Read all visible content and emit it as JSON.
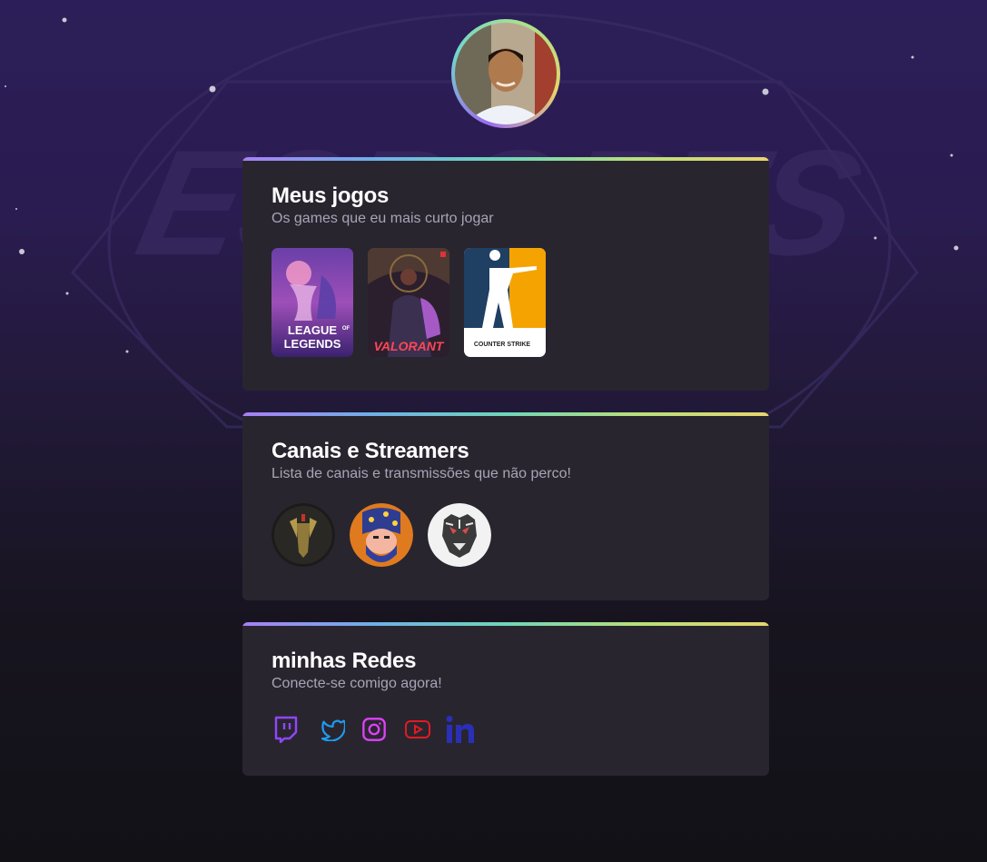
{
  "profile": {
    "avatar_alt": "Foto de perfil"
  },
  "sections": {
    "games": {
      "title": "Meus jogos",
      "subtitle": "Os games que eu mais curto jogar",
      "items": [
        {
          "name": "League of Legends",
          "line1": "LEAGUE",
          "line2": "LEGENDS",
          "small": "OF"
        },
        {
          "name": "Valorant",
          "label": "VALORANT"
        },
        {
          "name": "Counter-Strike",
          "label": "COUNTER STRIKE"
        }
      ]
    },
    "channels": {
      "title": "Canais e Streamers",
      "subtitle": "Lista de canais e transmissões que não perco!",
      "items": [
        "channel-1",
        "channel-2",
        "channel-3"
      ]
    },
    "social": {
      "title": "minhas Redes",
      "subtitle": "Conecte-se comigo agora!",
      "items": [
        {
          "icon": "twitch-icon",
          "color": "#9146ff"
        },
        {
          "icon": "twitter-icon",
          "color": "#1d9bf0"
        },
        {
          "icon": "instagram-icon",
          "color": "#e040fb"
        },
        {
          "icon": "youtube-icon",
          "color": "#e01b24"
        },
        {
          "icon": "linkedin-icon",
          "color": "#2a2fb8"
        }
      ]
    }
  }
}
